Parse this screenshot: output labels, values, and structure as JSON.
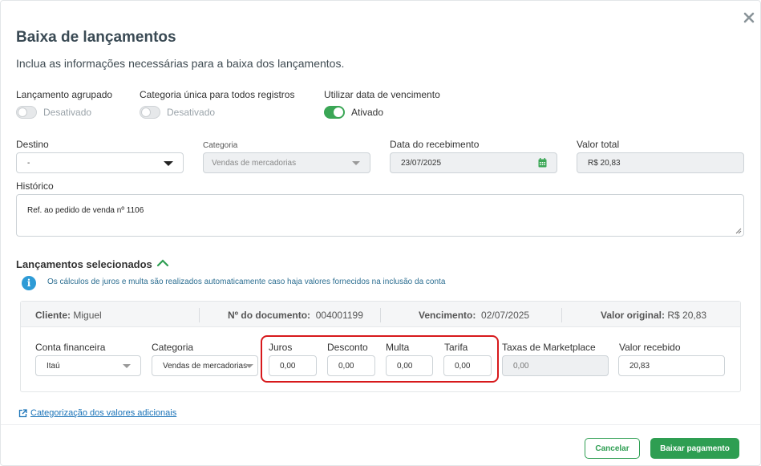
{
  "modal": {
    "title": "Baixa de lançamentos",
    "subtitle": "Inclua as informações necessárias para a baixa dos lançamentos."
  },
  "toggles": [
    {
      "label": "Lançamento agrupado",
      "state": "Desativado",
      "on": false
    },
    {
      "label": "Categoria única para todos registros",
      "state": "Desativado",
      "on": false
    },
    {
      "label": "Utilizar data de vencimento",
      "state": "Ativado",
      "on": true
    }
  ],
  "fields": {
    "destino_label": "Destino",
    "destino_value": "-",
    "categoria_label": "Categoria",
    "categoria_value": "Vendas de mercadorias",
    "data_label": "Data do recebimento",
    "data_value": "23/07/2025",
    "valor_total_label": "Valor total",
    "valor_total_value": "R$ 20,83",
    "historico_label": "Histórico",
    "historico_value": "Ref. ao pedido de venda nº 1106"
  },
  "selected": {
    "title": "Lançamentos selecionados",
    "info": "Os cálculos de juros e multa são realizados automaticamente caso haja valores fornecidos na inclusão da conta",
    "header": {
      "cliente_label": "Cliente:",
      "cliente_value": "Miguel",
      "doc_label": "Nº do documento:",
      "doc_value": "004001199",
      "venc_label": "Vencimento:",
      "venc_value": "02/07/2025",
      "orig_label": "Valor original:",
      "orig_value": "R$ 20,83"
    },
    "row": {
      "conta_label": "Conta financeira",
      "conta_value": "Itaú",
      "categoria_label": "Categoria",
      "categoria_value": "Vendas de mercadorias",
      "juros_label": "Juros",
      "juros_value": "0,00",
      "desconto_label": "Desconto",
      "desconto_value": "0,00",
      "multa_label": "Multa",
      "multa_value": "0,00",
      "tarifa_label": "Tarifa",
      "tarifa_value": "0,00",
      "taxas_label": "Taxas de Marketplace",
      "taxas_value": "0,00",
      "recebido_label": "Valor recebido",
      "recebido_value": "20,83"
    }
  },
  "link": "Categorização dos valores adicionais",
  "buttons": {
    "cancel": "Cancelar",
    "confirm": "Baixar pagamento"
  },
  "colors": {
    "accent_green": "#2e9e52",
    "info_blue": "#2e9bd6",
    "highlight_red": "#d7191c"
  }
}
